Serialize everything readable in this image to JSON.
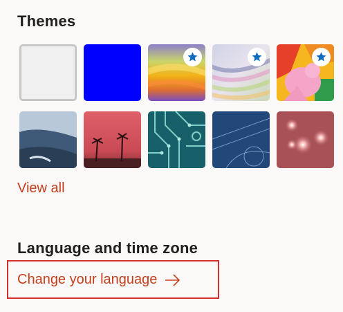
{
  "themes": {
    "title": "Themes",
    "view_all": "View all",
    "tiles": [
      {
        "name": "Default",
        "selected": true,
        "premium": false
      },
      {
        "name": "Blue",
        "premium": false
      },
      {
        "name": "Rainbow",
        "premium": true
      },
      {
        "name": "Prism",
        "premium": true
      },
      {
        "name": "Unicorn",
        "premium": true
      },
      {
        "name": "Mountain",
        "premium": false
      },
      {
        "name": "Palm",
        "premium": false
      },
      {
        "name": "Circuit",
        "premium": false
      },
      {
        "name": "Blueprint",
        "premium": false
      },
      {
        "name": "Lights",
        "premium": false
      }
    ]
  },
  "language": {
    "title": "Language and time zone",
    "change_link": "Change your language"
  },
  "colors": {
    "link": "#c43e1c",
    "highlight_box": "#d32f2f",
    "star": "#0f6cbd"
  }
}
